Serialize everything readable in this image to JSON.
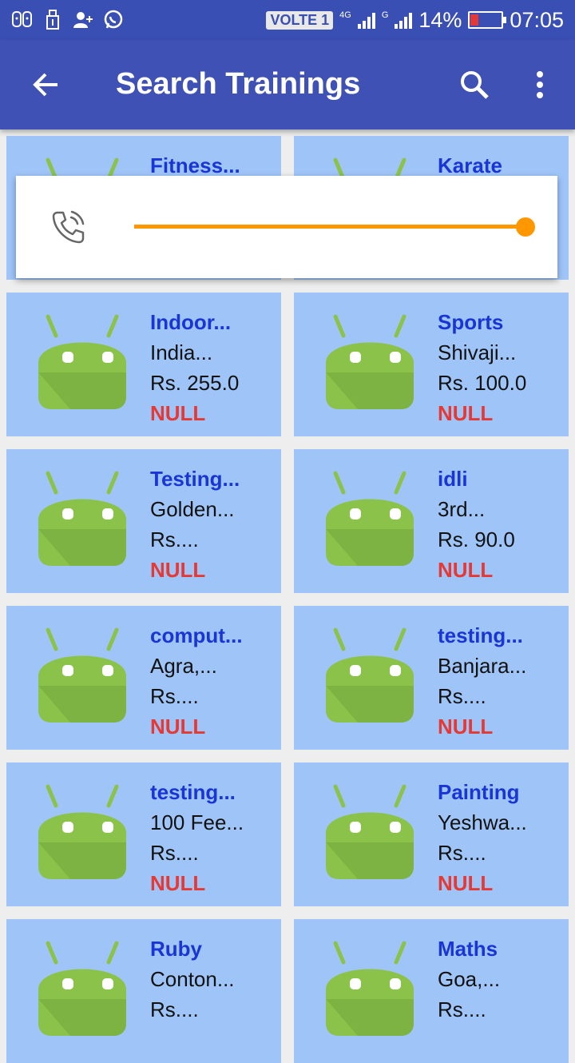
{
  "status_bar": {
    "volte": "VOLTE 1",
    "net1_label": "4G",
    "net2_label": "G",
    "battery": "14%",
    "time": "07:05"
  },
  "app_bar": {
    "title": "Search Trainings",
    "back_icon": "arrow-back-icon",
    "search_icon": "search-icon",
    "more_icon": "more-vert-icon"
  },
  "volume_panel": {
    "icon": "phone-call-icon",
    "level": 1.0,
    "accent": "#ff9800"
  },
  "colors": {
    "app_bar": "#3f51b5",
    "card_bg": "#9fc5f8",
    "name_text": "#1a35d6",
    "status_text": "#e53935",
    "robot_green": "#8bc34a"
  },
  "trainings": [
    {
      "name": "Fitness...",
      "location": "",
      "price": "",
      "status": ""
    },
    {
      "name": "Karate",
      "location": "",
      "price": "",
      "status": ""
    },
    {
      "name": "Indoor...",
      "location": "India...",
      "price": "Rs. 255.0",
      "status": "NULL"
    },
    {
      "name": "Sports",
      "location": "Shivaji...",
      "price": "Rs. 100.0",
      "status": "NULL"
    },
    {
      "name": "Testing...",
      "location": "Golden...",
      "price": "Rs....",
      "status": "NULL"
    },
    {
      "name": "idli",
      "location": "3rd...",
      "price": "Rs. 90.0",
      "status": "NULL"
    },
    {
      "name": "comput...",
      "location": "Agra,...",
      "price": "Rs....",
      "status": "NULL"
    },
    {
      "name": "testing...",
      "location": "Banjara...",
      "price": "Rs....",
      "status": "NULL"
    },
    {
      "name": "testing...",
      "location": "100 Fee...",
      "price": "Rs....",
      "status": "NULL"
    },
    {
      "name": "Painting",
      "location": "Yeshwa...",
      "price": "Rs....",
      "status": "NULL"
    },
    {
      "name": "Ruby",
      "location": "Conton...",
      "price": "Rs....",
      "status": ""
    },
    {
      "name": "Maths",
      "location": "Goa,...",
      "price": "Rs....",
      "status": ""
    }
  ]
}
